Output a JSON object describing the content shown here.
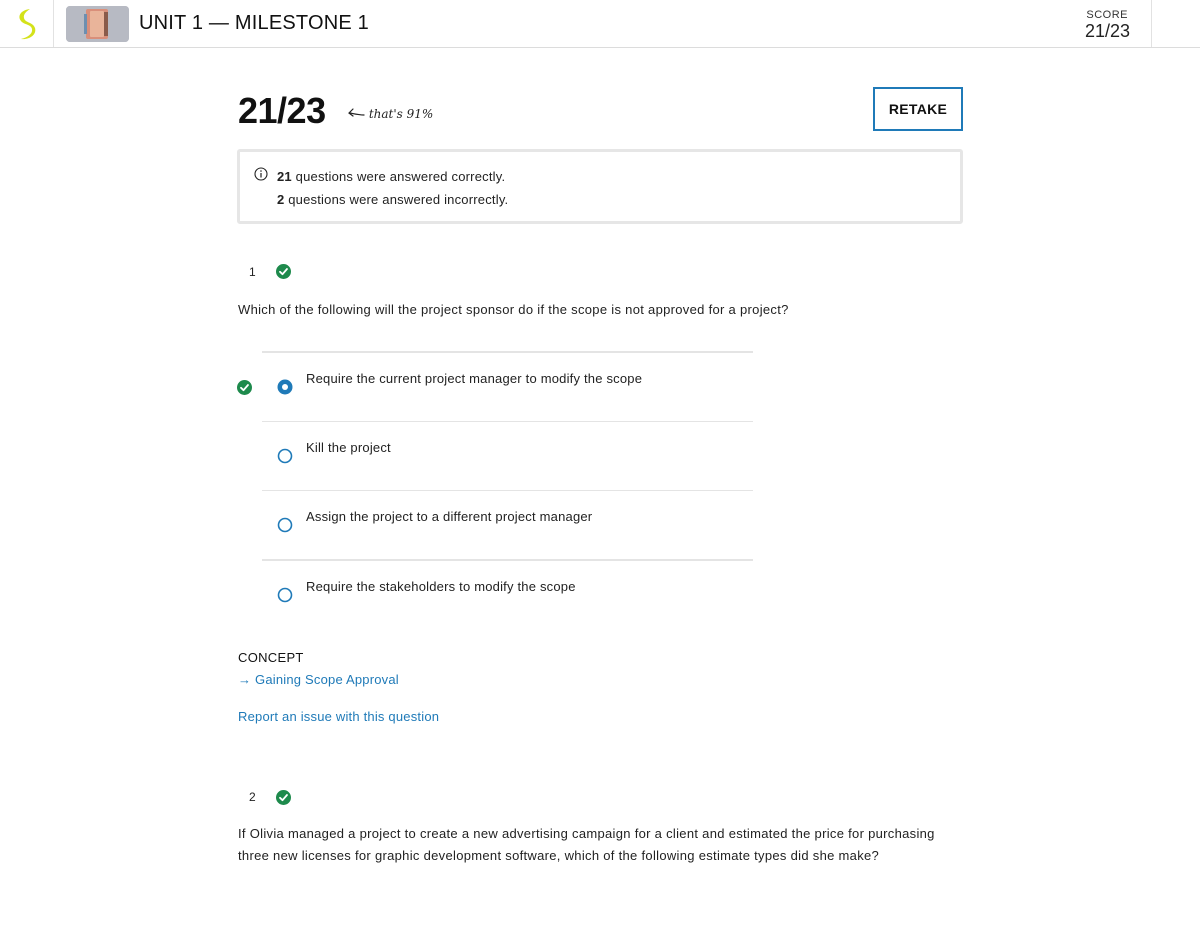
{
  "header": {
    "unit_title": "UNIT 1 — MILESTONE 1",
    "score_label": "SCORE",
    "score_value": "21/23"
  },
  "results": {
    "score": "21/23",
    "percent_note": "that's 91%",
    "retake_label": "RETAKE",
    "correct_count": "21",
    "correct_text": " questions were answered correctly.",
    "incorrect_count": "2",
    "incorrect_text": " questions were answered incorrectly."
  },
  "questions": [
    {
      "number": "1",
      "status": "correct",
      "text": "Which of the following will the project sponsor do if the scope is not approved for a project?",
      "options": [
        {
          "label": "Require the current project manager to modify the scope",
          "selected": true,
          "correct": true
        },
        {
          "label": "Kill the project",
          "selected": false,
          "correct": false
        },
        {
          "label": "Assign the project to a different project manager",
          "selected": false,
          "correct": false
        },
        {
          "label": "Require the stakeholders to modify the scope",
          "selected": false,
          "correct": false
        }
      ],
      "concept_label": "CONCEPT",
      "concept_link": "→ Gaining Scope Approval",
      "report_link": "Report an issue with this question"
    },
    {
      "number": "2",
      "status": "correct",
      "text": "If Olivia managed a project to create a new advertising campaign for a client and estimated the price for purchasing three new licenses for graphic development software, which of the following estimate types did she make?"
    }
  ],
  "colors": {
    "accent_blue": "#1f7ab8",
    "correct_green": "#1e8a4c",
    "logo_yellow": "#d4e21a"
  }
}
